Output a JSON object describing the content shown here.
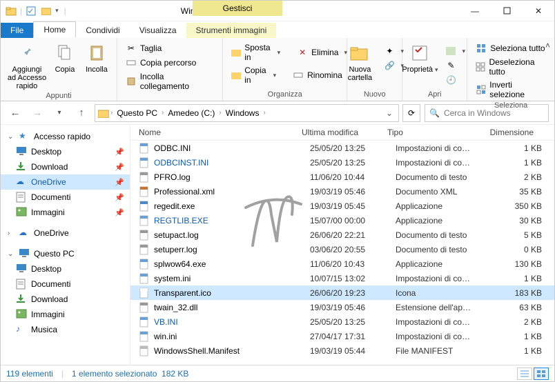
{
  "window": {
    "title": "Windows",
    "manage_label": "Gestisci"
  },
  "tabs": {
    "file": "File",
    "home": "Home",
    "share": "Condividi",
    "view": "Visualizza",
    "tool": "Strumenti immagini"
  },
  "ribbon": {
    "groups": {
      "clipboard": {
        "label": "Appunti",
        "pin": "Aggiungi ad Accesso rapido",
        "copy": "Copia",
        "paste": "Incolla",
        "cut": "Taglia",
        "copypath": "Copia percorso",
        "pastelnk": "Incolla collegamento"
      },
      "organize": {
        "label": "Organizza",
        "moveto": "Sposta in",
        "copyto": "Copia in",
        "delete": "Elimina",
        "rename": "Rinomina"
      },
      "new": {
        "label": "Nuovo",
        "newfolder": "Nuova cartella"
      },
      "open": {
        "label": "Apri",
        "properties": "Proprietà"
      },
      "select": {
        "label": "Seleziona",
        "selall": "Seleziona tutto",
        "selnone": "Deseleziona tutto",
        "invsel": "Inverti selezione"
      }
    }
  },
  "nav": {
    "crumbs": [
      "Questo PC",
      "Amedeo (C:)",
      "Windows"
    ],
    "search_placeholder": "Cerca in Windows"
  },
  "sidebar": {
    "quick": "Accesso rapido",
    "items_quick": [
      "Desktop",
      "Download",
      "OneDrive",
      "Documenti",
      "Immagini"
    ],
    "onedrive": "OneDrive",
    "thispc": "Questo PC",
    "items_pc": [
      "Desktop",
      "Documenti",
      "Download",
      "Immagini",
      "Musica"
    ]
  },
  "columns": {
    "name": "Nome",
    "mod": "Ultima modifica",
    "type": "Tipo",
    "size": "Dimensione"
  },
  "files": [
    {
      "name": "ODBC.INI",
      "mod": "25/05/20 13:25",
      "type": "Impostazioni di co…",
      "size": "1 KB",
      "icon": "ini",
      "link": false,
      "sel": false
    },
    {
      "name": "ODBCINST.INI",
      "mod": "25/05/20 13:25",
      "type": "Impostazioni di co…",
      "size": "1 KB",
      "icon": "ini",
      "link": true,
      "sel": false
    },
    {
      "name": "PFRO.log",
      "mod": "11/06/20 10:44",
      "type": "Documento di testo",
      "size": "2 KB",
      "icon": "txt",
      "link": false,
      "sel": false
    },
    {
      "name": "Professional.xml",
      "mod": "19/03/19 05:46",
      "type": "Documento XML",
      "size": "35 KB",
      "icon": "xml",
      "link": false,
      "sel": false
    },
    {
      "name": "regedit.exe",
      "mod": "19/03/19 05:45",
      "type": "Applicazione",
      "size": "350 KB",
      "icon": "reg",
      "link": false,
      "sel": false
    },
    {
      "name": "REGTLIB.EXE",
      "mod": "15/07/00 00:00",
      "type": "Applicazione",
      "size": "30 KB",
      "icon": "exe",
      "link": true,
      "sel": false
    },
    {
      "name": "setupact.log",
      "mod": "26/06/20 22:21",
      "type": "Documento di testo",
      "size": "5 KB",
      "icon": "txt",
      "link": false,
      "sel": false
    },
    {
      "name": "setuperr.log",
      "mod": "03/06/20 20:55",
      "type": "Documento di testo",
      "size": "0 KB",
      "icon": "txt",
      "link": false,
      "sel": false
    },
    {
      "name": "splwow64.exe",
      "mod": "11/06/20 10:43",
      "type": "Applicazione",
      "size": "130 KB",
      "icon": "exe",
      "link": false,
      "sel": false
    },
    {
      "name": "system.ini",
      "mod": "10/07/15 13:02",
      "type": "Impostazioni di co…",
      "size": "1 KB",
      "icon": "ini",
      "link": false,
      "sel": false
    },
    {
      "name": "Transparent.ico",
      "mod": "26/06/20 19:23",
      "type": "Icona",
      "size": "183 KB",
      "icon": "blank",
      "link": false,
      "sel": true
    },
    {
      "name": "twain_32.dll",
      "mod": "19/03/19 05:46",
      "type": "Estensione dell'ap…",
      "size": "63 KB",
      "icon": "dll",
      "link": false,
      "sel": false
    },
    {
      "name": "VB.INI",
      "mod": "25/05/20 13:25",
      "type": "Impostazioni di co…",
      "size": "2 KB",
      "icon": "ini",
      "link": true,
      "sel": false
    },
    {
      "name": "win.ini",
      "mod": "27/04/17 17:31",
      "type": "Impostazioni di co…",
      "size": "1 KB",
      "icon": "ini",
      "link": false,
      "sel": false
    },
    {
      "name": "WindowsShell.Manifest",
      "mod": "19/03/19 05:44",
      "type": "File MANIFEST",
      "size": "1 KB",
      "icon": "file",
      "link": false,
      "sel": false
    }
  ],
  "status": {
    "items": "119 elementi",
    "sel": "1 elemento selezionato",
    "size": "182 KB"
  }
}
